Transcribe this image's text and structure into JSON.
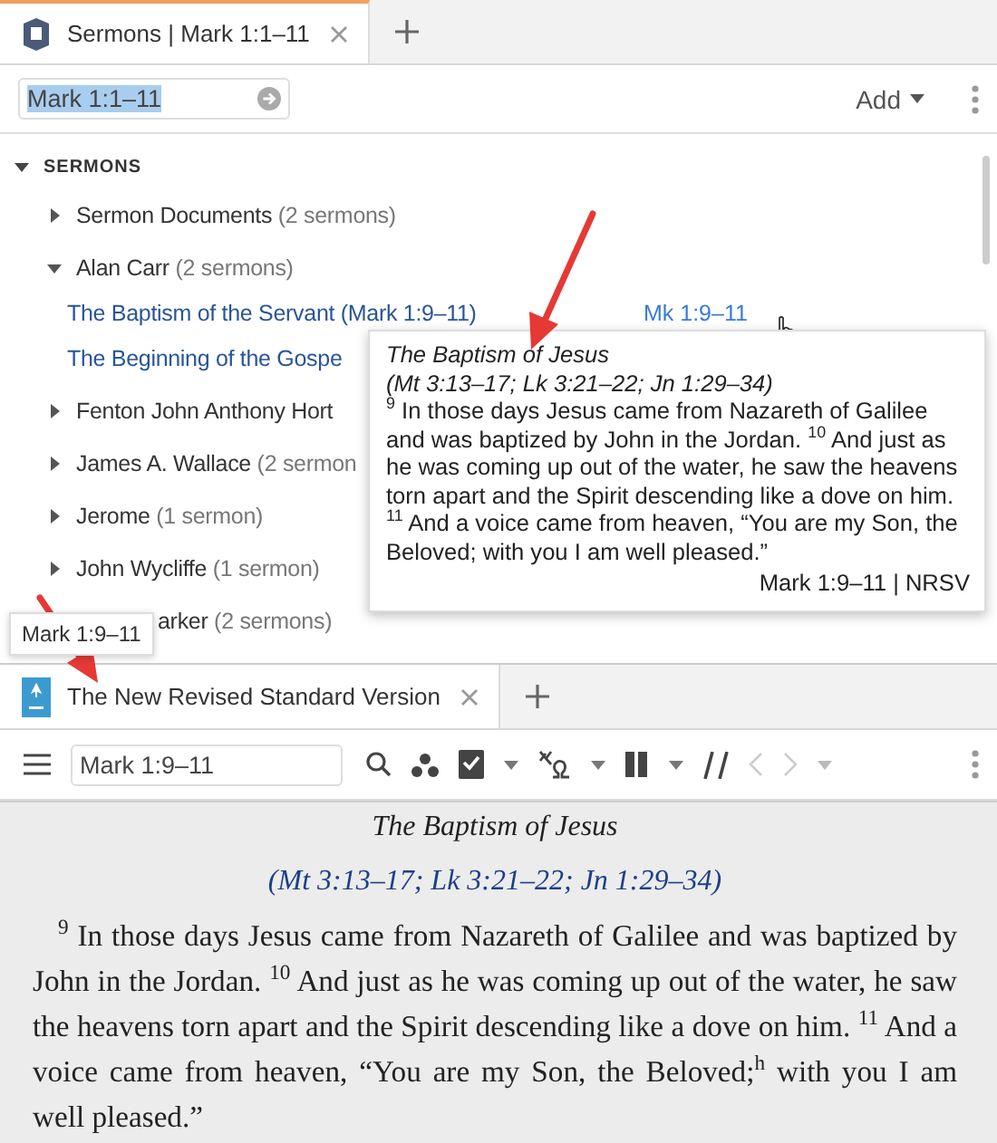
{
  "top_panel": {
    "tabs": [
      {
        "label": "Sermons | Mark 1:1–11",
        "selected": true
      }
    ],
    "reference": {
      "value": "Mark 1:1–11",
      "text_selected": true
    },
    "add_button": "Add",
    "section": {
      "label": "SERMONS",
      "expanded": true,
      "items": [
        {
          "name": "Sermon Documents",
          "count": "(2 sermons)",
          "expanded": false
        },
        {
          "name": "Alan Carr",
          "count": "(2 sermons)",
          "expanded": true,
          "children": [
            {
              "title": "The Baptism of the Servant (Mark 1:9–11)",
              "ref": "Mk 1:9–11"
            },
            {
              "title": "The Beginning of the Gospe"
            }
          ]
        },
        {
          "name": "Fenton John Anthony Hort",
          "expanded": false
        },
        {
          "name": "James A. Wallace",
          "count": "(2 sermon",
          "expanded": false
        },
        {
          "name": "Jerome",
          "count": "(1 sermon)",
          "expanded": false
        },
        {
          "name": "John Wycliffe",
          "count": "(1 sermon)",
          "expanded": false
        },
        {
          "name": "arker",
          "count": "(2 sermons)",
          "kind": "covered"
        }
      ]
    },
    "popup": {
      "title": "The Baptism of Jesus",
      "parallels": "(Mt 3:13–17; Lk 3:21–22; Jn 1:29–34)",
      "text": "$^{9}$ In those days Jesus came from Nazareth of Galilee and was baptized by John in the Jordan. $^{10}$ And just as he was coming up out of the water, he saw the heavens torn apart and the Spirit descending like a dove on him. $^{11}$ And a voice came from heaven, “You are my Son, the Beloved; with you I am well pleased.”",
      "source": "Mark 1:9–11 | NRSV"
    },
    "hover_tooltip": "Mark 1:9–11"
  },
  "bottom_panel": {
    "tabs": [
      {
        "label": "The New Revised Standard Version",
        "selected": true
      }
    ],
    "reference": {
      "value": "Mark 1:9–11"
    },
    "heading": "The Baptism of Jesus",
    "parallels": "(Mt 3:13–17; Lk 3:21–22; Jn 1:29–34)",
    "text": "$^{9}$ In those days Jesus came from Nazareth of Galilee and was baptized by John in the Jordan. $^{10}$ And just as he was coming up out of the water, he saw the heavens torn apart and the Spirit descending like a dove on him. $^{11}$ And a voice came from heaven, “You are my Son, the Beloved;$^{h}$ with you I am well pleased.”"
  }
}
